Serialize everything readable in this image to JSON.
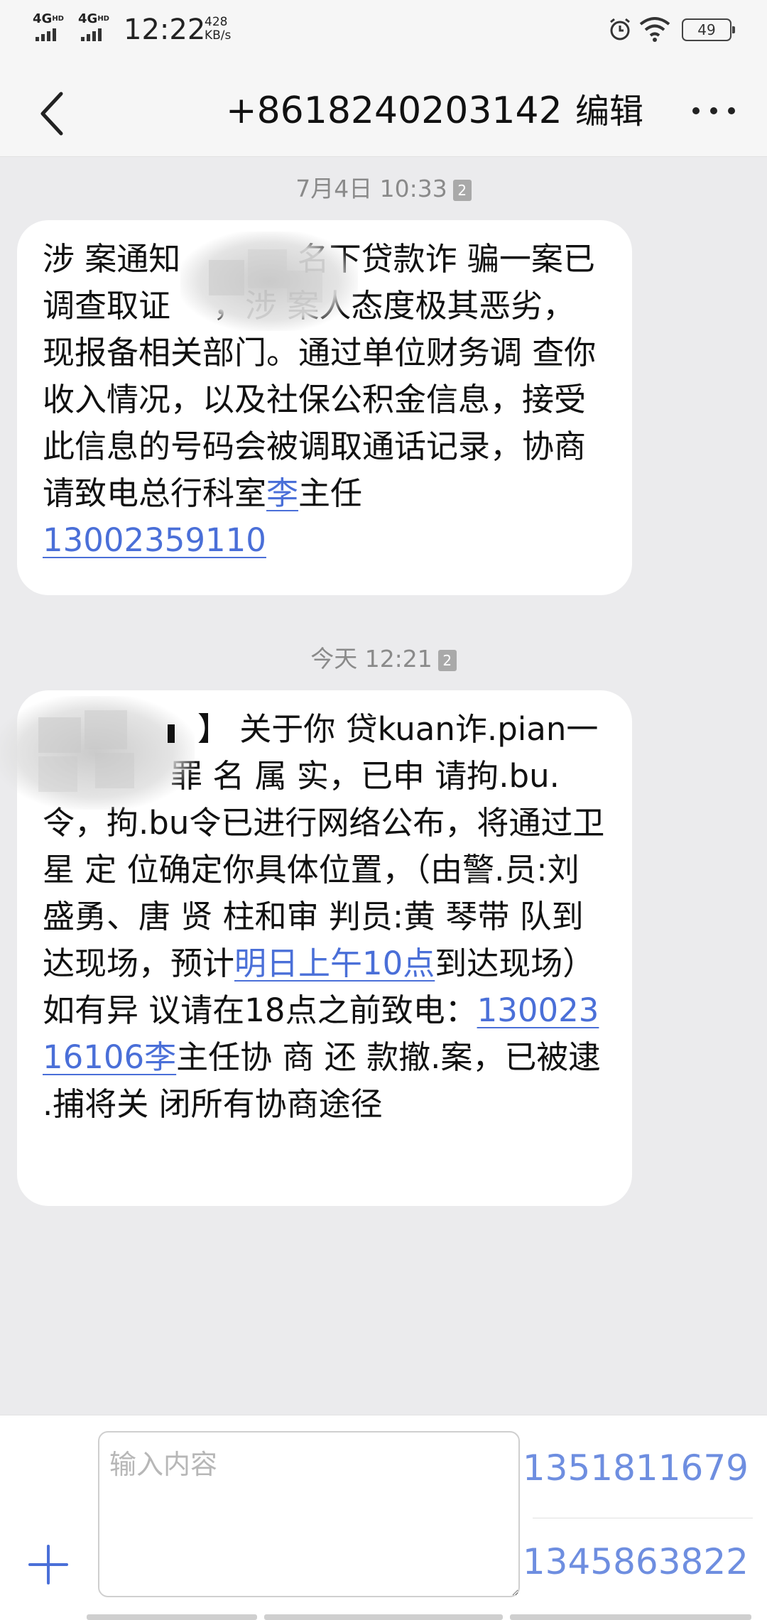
{
  "status_bar": {
    "network_1": "4G",
    "network_1_hd": "HD",
    "network_2": "4G",
    "network_2_hd": "HD",
    "time": "12:22",
    "speed_value": "428",
    "speed_unit": "KB/s",
    "battery": "49",
    "icons": [
      "signal-icon",
      "alarm-icon",
      "wifi-icon",
      "battery-icon"
    ]
  },
  "header": {
    "title": "+8618240203142",
    "edit_label": "编辑",
    "icons": [
      "back-chevron-icon",
      "more-dots-icon"
    ]
  },
  "messages": [
    {
      "timestamp": "7月4日 10:33",
      "sim_slot": "2",
      "segments": [
        "涉 案通知 ",
        "名下贷款诈 骗一案已调查取证",
        "，涉 案人态度极其恶劣，现报备相关部门。通过单位财务调 查你收入情况，以及社保公积金信息，接受此信息的号码会被调取通话记录，协商请致电总行科室",
        "李",
        "主任",
        "13002359110"
      ]
    },
    {
      "timestamp": "今天 12:21",
      "sim_slot": "2",
      "segments": [
        "】 关于你 贷kuan诈.pian一",
        "罪 名 属 实，已申 请拘.bu.令，拘.bu令已进行网络公布，将通过卫 星 定 位确定你具体位置，（由警.员:刘 盛勇、唐 贤 柱和审 判员:黄 琴带 队到达现场，预计",
        "明日上午10点",
        "到达现场）如有异 议请在18点之前致电：",
        "13002316106李",
        "主任协 商 还 款撤.案，已被逮  .捕将关 闭所有协商途径"
      ]
    }
  ],
  "composer": {
    "placeholder": "输入内容",
    "sim_numbers": [
      "1351811679",
      "1345863822"
    ]
  },
  "colors": {
    "link": "#4a6fd8",
    "sim_number": "#6e8ee0",
    "background": "#ebebed"
  }
}
